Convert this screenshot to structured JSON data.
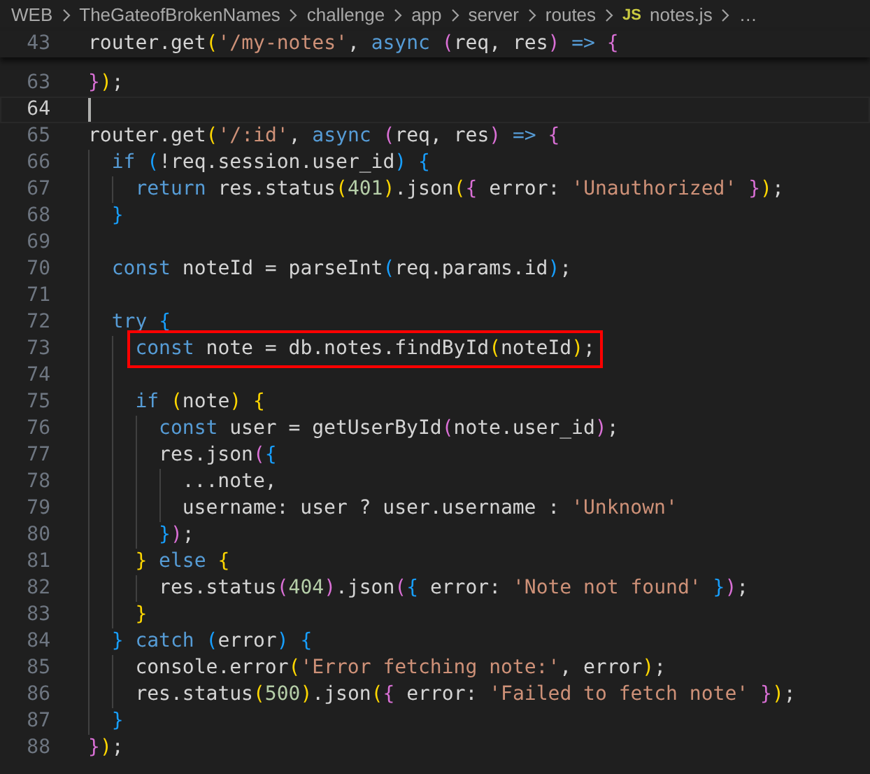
{
  "breadcrumbs": [
    {
      "kind": "folder",
      "label": "WEB"
    },
    {
      "kind": "folder",
      "label": "TheGateofBrokenNames"
    },
    {
      "kind": "folder",
      "label": "challenge"
    },
    {
      "kind": "folder",
      "label": "app"
    },
    {
      "kind": "folder",
      "label": "server"
    },
    {
      "kind": "folder",
      "label": "routes"
    },
    {
      "kind": "file",
      "icon_text": "JS",
      "label": "notes.js"
    },
    {
      "kind": "more",
      "label": "…"
    }
  ],
  "sticky_line": {
    "number": "43",
    "segments": [
      {
        "text": "router.get",
        "color": "#d4d4d4"
      },
      {
        "text": "(",
        "color": "#ffd700"
      },
      {
        "text": "'/my-notes'",
        "color": "#ce9178"
      },
      {
        "text": ", ",
        "color": "#d4d4d4"
      },
      {
        "text": "async ",
        "color": "#569cd6"
      },
      {
        "text": "(",
        "color": "#da70d6"
      },
      {
        "text": "req, res",
        "color": "#d4d4d4"
      },
      {
        "text": ") ",
        "color": "#da70d6"
      },
      {
        "text": "=> ",
        "color": "#569cd6"
      },
      {
        "text": "{",
        "color": "#da70d6"
      }
    ]
  },
  "lines": [
    {
      "number": "63",
      "segments": [
        {
          "text": "}",
          "color": "#da70d6"
        },
        {
          "text": ")",
          "color": "#ffd700"
        },
        {
          "text": ";",
          "color": "#d4d4d4"
        }
      ]
    },
    {
      "number": "64",
      "active": true
    },
    {
      "number": "65",
      "segments": [
        {
          "text": "router.get",
          "color": "#d4d4d4"
        },
        {
          "text": "(",
          "color": "#ffd700"
        },
        {
          "text": "'/:id'",
          "color": "#ce9178"
        },
        {
          "text": ", ",
          "color": "#d4d4d4"
        },
        {
          "text": "async ",
          "color": "#569cd6"
        },
        {
          "text": "(",
          "color": "#da70d6"
        },
        {
          "text": "req, res",
          "color": "#d4d4d4"
        },
        {
          "text": ") ",
          "color": "#da70d6"
        },
        {
          "text": "=> ",
          "color": "#569cd6"
        },
        {
          "text": "{",
          "color": "#da70d6"
        }
      ]
    },
    {
      "number": "66",
      "segments": [
        {
          "text": "  if ",
          "color": "#569cd6"
        },
        {
          "text": "(",
          "color": "#179fff"
        },
        {
          "text": "!req.session.user_id",
          "color": "#d4d4d4"
        },
        {
          "text": ") {",
          "color": "#179fff"
        }
      ]
    },
    {
      "number": "67",
      "segments": [
        {
          "text": "    return ",
          "color": "#569cd6"
        },
        {
          "text": "res.status",
          "color": "#d4d4d4"
        },
        {
          "text": "(",
          "color": "#ffd700"
        },
        {
          "text": "401",
          "color": "#b5cea8"
        },
        {
          "text": ")",
          "color": "#ffd700"
        },
        {
          "text": ".json",
          "color": "#d4d4d4"
        },
        {
          "text": "(",
          "color": "#ffd700"
        },
        {
          "text": "{ ",
          "color": "#da70d6"
        },
        {
          "text": "error: ",
          "color": "#d4d4d4"
        },
        {
          "text": "'Unauthorized' ",
          "color": "#ce9178"
        },
        {
          "text": "}",
          "color": "#da70d6"
        },
        {
          "text": ")",
          "color": "#ffd700"
        },
        {
          "text": ";",
          "color": "#d4d4d4"
        }
      ]
    },
    {
      "number": "68",
      "segments": [
        {
          "text": "  }",
          "color": "#179fff"
        }
      ]
    },
    {
      "number": "69"
    },
    {
      "number": "70",
      "segments": [
        {
          "text": "  const ",
          "color": "#569cd6"
        },
        {
          "text": "noteId = parseInt",
          "color": "#d4d4d4"
        },
        {
          "text": "(",
          "color": "#179fff"
        },
        {
          "text": "req.params.id",
          "color": "#d4d4d4"
        },
        {
          "text": ")",
          "color": "#179fff"
        },
        {
          "text": ";",
          "color": "#d4d4d4"
        }
      ]
    },
    {
      "number": "71"
    },
    {
      "number": "72",
      "segments": [
        {
          "text": "  try ",
          "color": "#569cd6"
        },
        {
          "text": "{",
          "color": "#179fff"
        }
      ]
    },
    {
      "number": "73",
      "highlighted": true,
      "segments": [
        {
          "text": "    const ",
          "color": "#569cd6"
        },
        {
          "text": "note = db.notes.findById",
          "color": "#d4d4d4"
        },
        {
          "text": "(",
          "color": "#ffd700"
        },
        {
          "text": "noteId",
          "color": "#d4d4d4"
        },
        {
          "text": ")",
          "color": "#ffd700"
        },
        {
          "text": ";",
          "color": "#d4d4d4"
        }
      ]
    },
    {
      "number": "74"
    },
    {
      "number": "75",
      "segments": [
        {
          "text": "    if ",
          "color": "#569cd6"
        },
        {
          "text": "(",
          "color": "#ffd700"
        },
        {
          "text": "note",
          "color": "#d4d4d4"
        },
        {
          "text": ") {",
          "color": "#ffd700"
        }
      ]
    },
    {
      "number": "76",
      "segments": [
        {
          "text": "      const ",
          "color": "#569cd6"
        },
        {
          "text": "user = getUserById",
          "color": "#d4d4d4"
        },
        {
          "text": "(",
          "color": "#da70d6"
        },
        {
          "text": "note.user_id",
          "color": "#d4d4d4"
        },
        {
          "text": ")",
          "color": "#da70d6"
        },
        {
          "text": ";",
          "color": "#d4d4d4"
        }
      ]
    },
    {
      "number": "77",
      "segments": [
        {
          "text": "      res.json",
          "color": "#d4d4d4"
        },
        {
          "text": "(",
          "color": "#da70d6"
        },
        {
          "text": "{",
          "color": "#179fff"
        }
      ]
    },
    {
      "number": "78",
      "segments": [
        {
          "text": "        ...note,",
          "color": "#d4d4d4"
        }
      ]
    },
    {
      "number": "79",
      "segments": [
        {
          "text": "        username: user ? user.username : ",
          "color": "#d4d4d4"
        },
        {
          "text": "'Unknown'",
          "color": "#ce9178"
        }
      ]
    },
    {
      "number": "80",
      "segments": [
        {
          "text": "      }",
          "color": "#179fff"
        },
        {
          "text": ")",
          "color": "#da70d6"
        },
        {
          "text": ";",
          "color": "#d4d4d4"
        }
      ]
    },
    {
      "number": "81",
      "segments": [
        {
          "text": "    } ",
          "color": "#ffd700"
        },
        {
          "text": "else ",
          "color": "#569cd6"
        },
        {
          "text": "{",
          "color": "#ffd700"
        }
      ]
    },
    {
      "number": "82",
      "segments": [
        {
          "text": "      res.status",
          "color": "#d4d4d4"
        },
        {
          "text": "(",
          "color": "#da70d6"
        },
        {
          "text": "404",
          "color": "#b5cea8"
        },
        {
          "text": ")",
          "color": "#da70d6"
        },
        {
          "text": ".json",
          "color": "#d4d4d4"
        },
        {
          "text": "(",
          "color": "#da70d6"
        },
        {
          "text": "{ ",
          "color": "#179fff"
        },
        {
          "text": "error: ",
          "color": "#d4d4d4"
        },
        {
          "text": "'Note not found' ",
          "color": "#ce9178"
        },
        {
          "text": "}",
          "color": "#179fff"
        },
        {
          "text": ")",
          "color": "#da70d6"
        },
        {
          "text": ";",
          "color": "#d4d4d4"
        }
      ]
    },
    {
      "number": "83",
      "segments": [
        {
          "text": "    }",
          "color": "#ffd700"
        }
      ]
    },
    {
      "number": "84",
      "segments": [
        {
          "text": "  } ",
          "color": "#179fff"
        },
        {
          "text": "catch ",
          "color": "#569cd6"
        },
        {
          "text": "(",
          "color": "#179fff"
        },
        {
          "text": "error",
          "color": "#d4d4d4"
        },
        {
          "text": ") {",
          "color": "#179fff"
        }
      ]
    },
    {
      "number": "85",
      "segments": [
        {
          "text": "    console.error",
          "color": "#d4d4d4"
        },
        {
          "text": "(",
          "color": "#ffd700"
        },
        {
          "text": "'Error fetching note:'",
          "color": "#ce9178"
        },
        {
          "text": ", error",
          "color": "#d4d4d4"
        },
        {
          "text": ")",
          "color": "#ffd700"
        },
        {
          "text": ";",
          "color": "#d4d4d4"
        }
      ]
    },
    {
      "number": "86",
      "segments": [
        {
          "text": "    res.status",
          "color": "#d4d4d4"
        },
        {
          "text": "(",
          "color": "#ffd700"
        },
        {
          "text": "500",
          "color": "#b5cea8"
        },
        {
          "text": ")",
          "color": "#ffd700"
        },
        {
          "text": ".json",
          "color": "#d4d4d4"
        },
        {
          "text": "(",
          "color": "#ffd700"
        },
        {
          "text": "{ ",
          "color": "#da70d6"
        },
        {
          "text": "error: ",
          "color": "#d4d4d4"
        },
        {
          "text": "'Failed to fetch note' ",
          "color": "#ce9178"
        },
        {
          "text": "}",
          "color": "#da70d6"
        },
        {
          "text": ")",
          "color": "#ffd700"
        },
        {
          "text": ";",
          "color": "#d4d4d4"
        }
      ]
    },
    {
      "number": "87",
      "segments": [
        {
          "text": "  }",
          "color": "#179fff"
        }
      ]
    },
    {
      "number": "88",
      "segments": [
        {
          "text": "}",
          "color": "#da70d6"
        },
        {
          "text": ")",
          "color": "#ffd700"
        },
        {
          "text": ";",
          "color": "#d4d4d4"
        }
      ]
    }
  ]
}
